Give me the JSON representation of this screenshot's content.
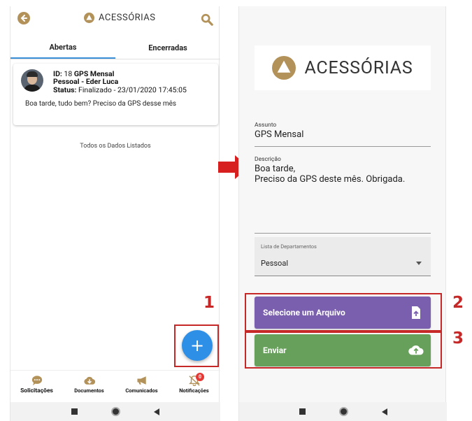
{
  "colors": {
    "brand_gold": "#b3925a",
    "tab_active": "#3a8fd8",
    "fab": "#2e8fe6",
    "file_button": "#7a5fae",
    "send_button": "#67a05a",
    "highlight": "#c62828"
  },
  "left_screen": {
    "header": {
      "brand": "ACESSÓRIAS",
      "back_icon": "arrow-left-icon",
      "search_icon": "search-icon"
    },
    "tabs": [
      {
        "label": "Abertas",
        "active": true
      },
      {
        "label": "Encerradas",
        "active": false
      }
    ],
    "ticket": {
      "id_label": "ID:",
      "id_value": "18",
      "subject": "GPS Mensal",
      "department_user": "Pessoal - Eder Luca",
      "status_label": "Status:",
      "status_value": "Finalizado - 23/01/2020 17:45:05",
      "message": "Boa tarde, tudo bem? Preciso da GPS desse mês"
    },
    "list_end_text": "Todos os Dados Listados",
    "fab_symbol": "+",
    "bottom_nav": [
      {
        "label": "Solicitações",
        "icon": "chat-icon",
        "active": true
      },
      {
        "label": "Documentos",
        "icon": "cloud-download-icon",
        "active": false
      },
      {
        "label": "Comunicados",
        "icon": "megaphone-icon",
        "active": false
      },
      {
        "label": "Notificações",
        "icon": "bell-off-icon",
        "active": false,
        "badge": "0"
      }
    ]
  },
  "right_screen": {
    "brand": "ACESSÓRIAS",
    "subject": {
      "label": "Assunto",
      "value": "GPS Mensal"
    },
    "description": {
      "label": "Descrição",
      "line1": "Boa tarde,",
      "line2": "Preciso da GPS deste mês. Obrigada."
    },
    "department_select": {
      "label": "Lista de Departamentos",
      "value": "Pessoal"
    },
    "file_button": {
      "label": "Selecione um Arquivo",
      "icon": "file-upload-icon"
    },
    "send_button": {
      "label": "Enviar",
      "icon": "cloud-upload-icon"
    }
  },
  "annotations": {
    "step1": "1",
    "step2": "2",
    "step3": "3"
  }
}
